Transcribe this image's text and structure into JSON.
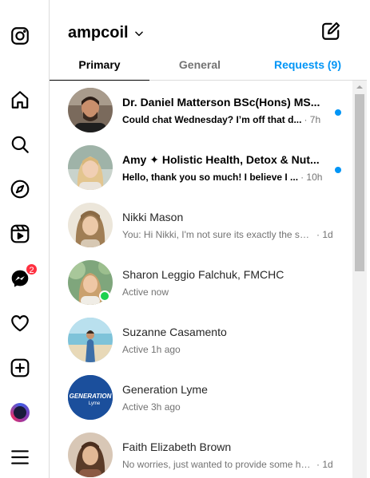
{
  "rail": {
    "icons": [
      "instagram-icon",
      "home-icon",
      "search-icon",
      "explore-icon",
      "reels-icon",
      "messenger-icon",
      "notifications-icon",
      "create-icon",
      "profile-icon",
      "menu-icon"
    ],
    "messenger_badge": "2"
  },
  "header": {
    "username": "ampcoil"
  },
  "tabs": {
    "primary": "Primary",
    "general": "General",
    "requests": "Requests (9)"
  },
  "threads": [
    {
      "name": "Dr. Daniel Matterson BSc(Hons) MS...",
      "message": "Could chat Wednesday? I’m off that d...",
      "time": "· 7h",
      "unread": true
    },
    {
      "name": "Amy ✦ Holistic Health, Detox & Nut...",
      "message": "Hello, thank you so much! I believe I ...",
      "time": "· 10h",
      "unread": true
    },
    {
      "name": "Nikki Mason",
      "message": "You: Hi Nikki, I'm not sure its exactly the sam...",
      "time": "· 1d",
      "unread": false
    },
    {
      "name": "Sharon Leggio Falchuk, FMCHC",
      "message": "Active now",
      "time": "",
      "unread": false,
      "online": true
    },
    {
      "name": "Suzanne Casamento",
      "message": "Active 1h ago",
      "time": "",
      "unread": false
    },
    {
      "name": "Generation Lyme",
      "message": "Active 3h ago",
      "time": "",
      "unread": false,
      "logo_text": "GENERATION",
      "logo_sub": "Lyme"
    },
    {
      "name": "Faith Elizabeth Brown",
      "message": "No worries, just wanted to provide some ho...",
      "time": "· 1d",
      "unread": false
    }
  ],
  "colors": {
    "accent": "#0095f6",
    "badge": "#ff3040",
    "online": "#1cd14f",
    "divider": "#dbdbdb"
  }
}
